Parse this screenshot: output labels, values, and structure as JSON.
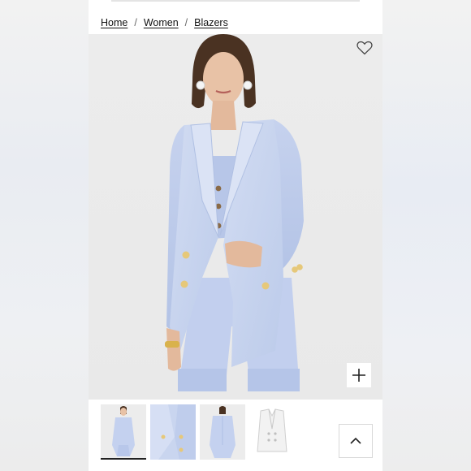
{
  "breadcrumb": {
    "items": [
      {
        "label": "Home"
      },
      {
        "label": "Women"
      },
      {
        "label": "Blazers"
      }
    ],
    "separator": "/"
  },
  "product_image": {
    "description_icon": "product-photo",
    "favorite_icon": "heart-icon",
    "zoom_icon": "plus-icon"
  },
  "thumbnails": {
    "count": 4,
    "selected_index": 0
  },
  "scroll_top_icon": "chevron-up-icon",
  "colors": {
    "blazer": "#c9d5ee",
    "background": "#ebebeb",
    "text": "#111111"
  }
}
